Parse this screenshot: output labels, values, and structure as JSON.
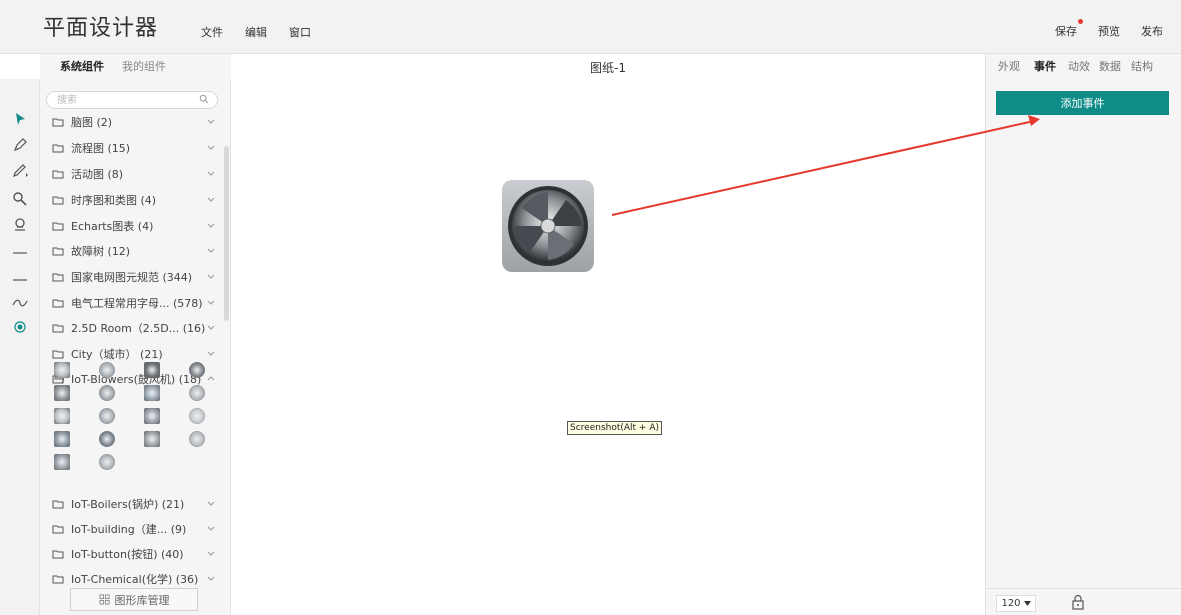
{
  "header": {
    "app_title": "平面设计器",
    "menu": [
      "文件",
      "编辑",
      "窗口"
    ],
    "actions": {
      "save": "保存",
      "preview": "预览",
      "publish": "发布"
    }
  },
  "library": {
    "tabs": {
      "system": "系统组件",
      "mine": "我的组件"
    },
    "search_placeholder": "搜索",
    "categories": [
      "脑图 (2)",
      "流程图 (15)",
      "活动图 (8)",
      "时序图和类图 (4)",
      "Echarts图表 (4)",
      "故障树 (12)",
      "国家电网图元规范 (344)",
      "电气工程常用字母... (578)",
      "2.5D Room（2.5D... (16)",
      "City（城市） (21)",
      "IoT-Blowers(鼓风机) (18)",
      "IoT-Boilers(锅炉) (21)",
      "IoT-building（建... (9)",
      "IoT-button(按钮) (40)",
      "IoT-Chemical(化学) (36)"
    ],
    "manage_button": "图形库管理"
  },
  "canvas": {
    "sheet_title": "图纸-1",
    "tooltip": "Screenshot(Alt + A)"
  },
  "props": {
    "tabs": [
      "外观",
      "事件",
      "动效",
      "数据",
      "结构"
    ],
    "active_tab": "事件",
    "add_event_button": "添加事件",
    "zoom": "120",
    "colors": {
      "accent": "#0f8c87",
      "arrow": "#e8382b"
    }
  }
}
